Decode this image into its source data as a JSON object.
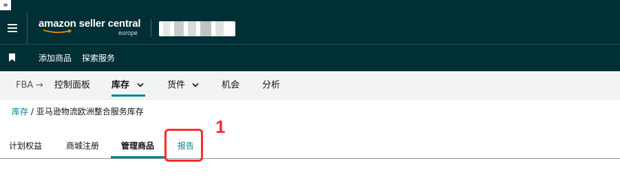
{
  "header": {
    "expand_glyph": "»",
    "logo_text": "amazon seller central",
    "logo_region": "europe"
  },
  "shortcuts": {
    "items": [
      {
        "label": "添加商品"
      },
      {
        "label": "探索服务"
      }
    ]
  },
  "nav": {
    "fba": "FBA",
    "arrow": "→",
    "items": [
      {
        "label": "控制面板"
      },
      {
        "label": "库存"
      },
      {
        "label": "货件"
      },
      {
        "label": "机会"
      },
      {
        "label": "分析"
      }
    ]
  },
  "breadcrumb": {
    "link": "库存",
    "separator": " / ",
    "current": "亚马逊物流欧洲整合服务库存"
  },
  "tabs": [
    {
      "label": "计划权益"
    },
    {
      "label": "商城注册"
    },
    {
      "label": "管理商品"
    },
    {
      "label": "报告"
    }
  ],
  "annotation": {
    "number": "1"
  },
  "colors": {
    "header_bg": "#002f36",
    "accent": "#008296",
    "nav_bg": "#f2f4f4",
    "highlight": "#ff2a2a"
  }
}
